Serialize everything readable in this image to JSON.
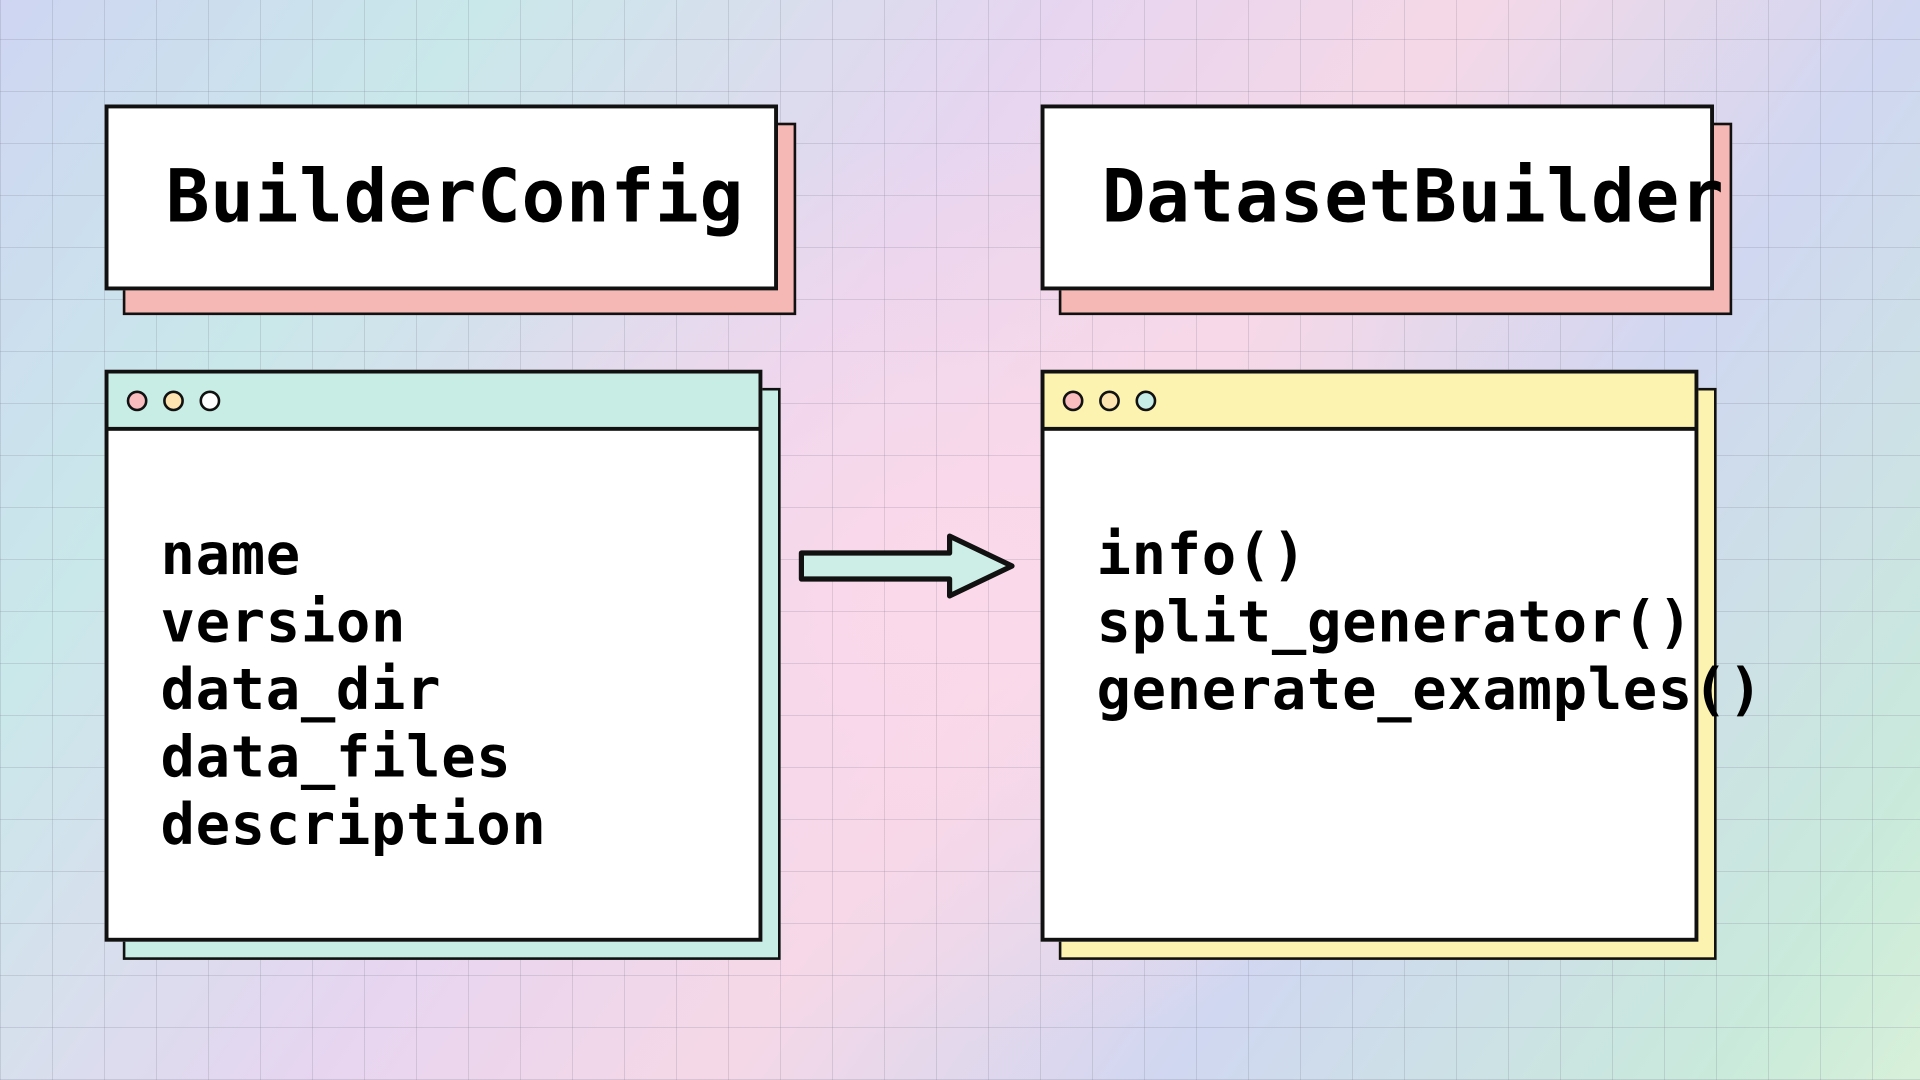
{
  "left": {
    "title": "BuilderConfig",
    "items": [
      "name",
      "version",
      "data_dir",
      "data_files",
      "description"
    ],
    "bar_color": "#c8ede4",
    "shadow_color": "#c8ede4",
    "dots": [
      "#f9bdbf",
      "#fde3b0",
      "#ffffff"
    ]
  },
  "right": {
    "title": "DatasetBuilder",
    "items": [
      "info()",
      "split_generator()",
      "generate_examples()"
    ],
    "bar_color": "#fdf3b0",
    "shadow_color": "#fdf3b0",
    "dots": [
      "#f9bdbf",
      "#fde3b0",
      "#c7ede9"
    ]
  },
  "arrow": {
    "fill": "#cdeee6"
  }
}
